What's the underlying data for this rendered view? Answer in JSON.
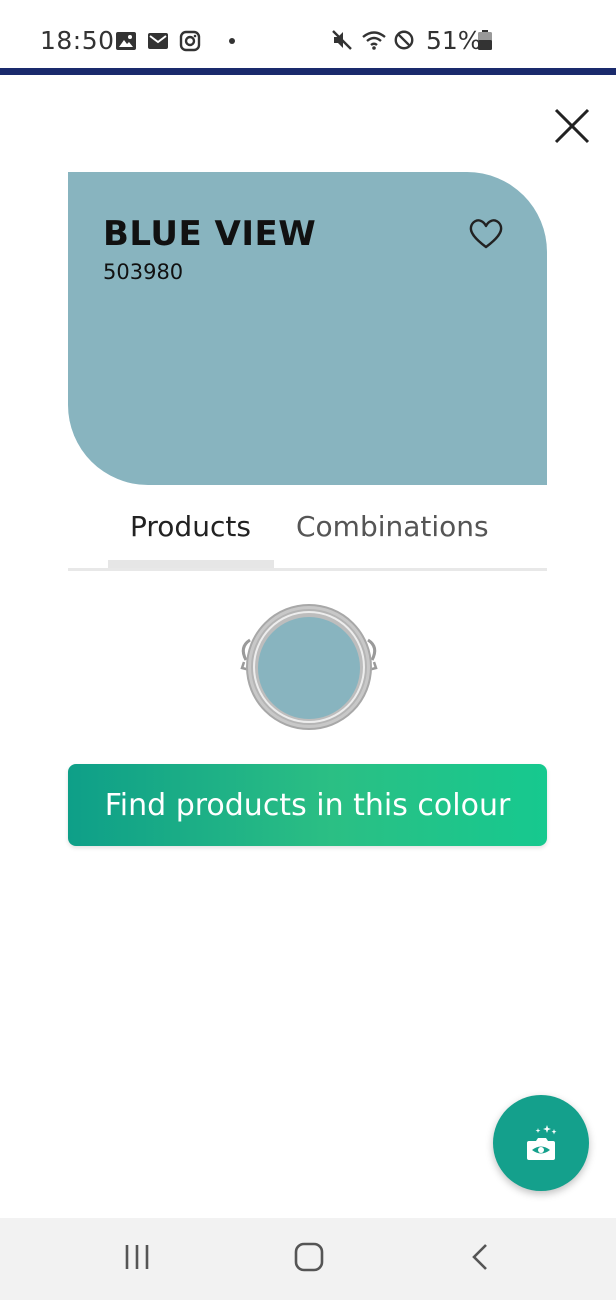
{
  "status_bar": {
    "time": "18:50",
    "battery": "51%",
    "left_icons": [
      "gallery-icon",
      "mail-icon",
      "instagram-icon",
      "dot-icon"
    ],
    "right_icons": [
      "mute-icon",
      "wifi-icon",
      "blocked-icon",
      "battery-icon"
    ]
  },
  "color": {
    "name": "BLUE VIEW",
    "code": "503980",
    "swatch_hex": "#88b4bf"
  },
  "tabs": [
    {
      "label": "Products",
      "active": true
    },
    {
      "label": "Combinations",
      "active": false
    }
  ],
  "cta": {
    "label": "Find products in this colour"
  },
  "icons": {
    "close": "close-icon",
    "favorite": "heart-icon",
    "fab": "camera-eye-icon",
    "nav_recents": "recents-icon",
    "nav_home": "home-icon",
    "nav_back": "back-icon"
  },
  "colors": {
    "accent": "#14a08c",
    "top_line": "#1a2a6c"
  }
}
